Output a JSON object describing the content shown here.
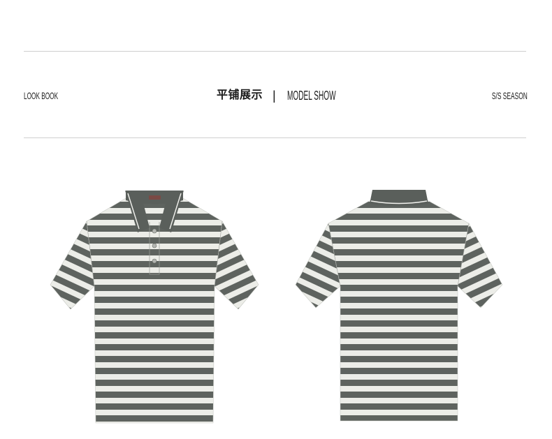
{
  "header": {
    "left_label": "LOOK BOOK",
    "center_label_cn": "平铺展示",
    "center_separator": "|",
    "center_label_en": "MODEL SHOW",
    "right_label": "S/S SEASON"
  },
  "colors": {
    "background": "#ffffff",
    "divider": "#cfcfcf",
    "text": "#1a1a1a",
    "stripe_dark": "#5e635f",
    "stripe_light": "#ecede8",
    "collar": "#5a5f5b",
    "collar_tipping": "#f2f2ee",
    "button": "#b4b6b2",
    "label": "#7a4a45"
  }
}
